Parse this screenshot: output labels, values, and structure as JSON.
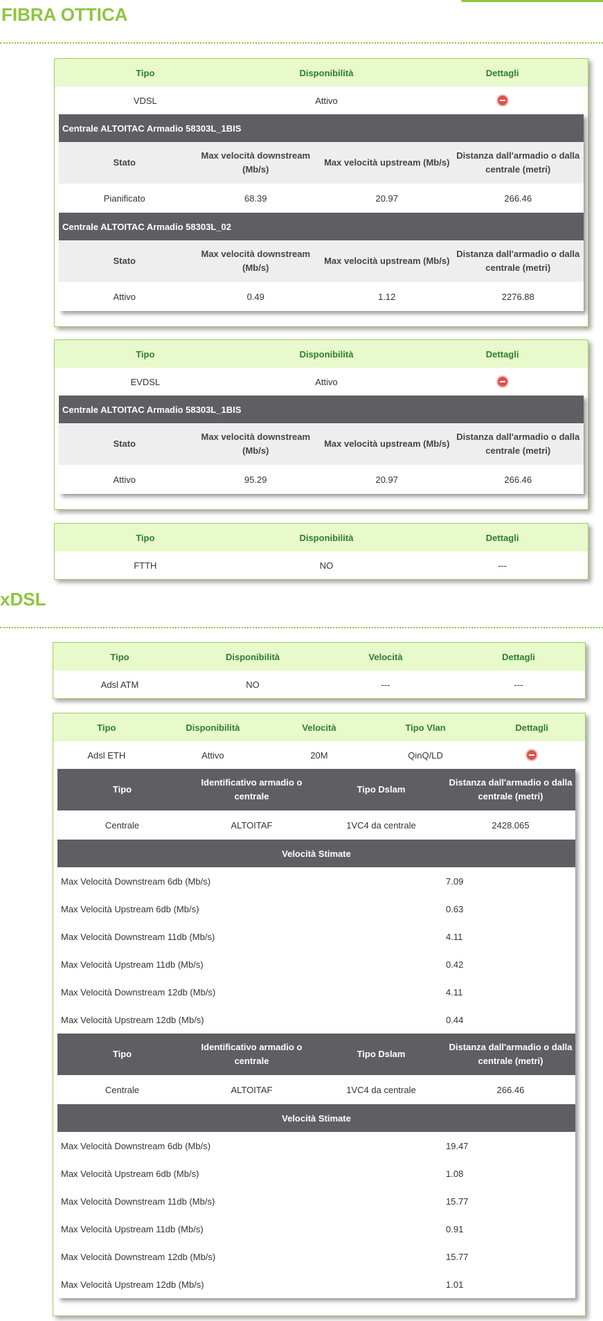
{
  "sections": {
    "fibra_title": "FIBRA OTTICA",
    "xdsl_title": "xDSL"
  },
  "fibra": {
    "headers": [
      "Tipo",
      "Disponibilità",
      "Dettagli"
    ],
    "sub_headers": [
      "Stato",
      "Max velocità downstream (Mb/s)",
      "Max velocità upstream (Mb/s)",
      "Distanza dall'armadio o dalla centrale (metri)"
    ],
    "vdsl": {
      "tipo": "VDSL",
      "disp": "Attivo",
      "dettagli_icon": "minus-circle-icon",
      "groups": [
        {
          "title": "Centrale ALTOITAC Armadio 58303L_1BIS",
          "stato": "Pianificato",
          "down": "68.39",
          "up": "20.97",
          "dist": "266.46"
        },
        {
          "title": "Centrale ALTOITAC Armadio 58303L_02",
          "stato": "Attivo",
          "down": "0.49",
          "up": "1.12",
          "dist": "2276.88"
        }
      ]
    },
    "evdsl": {
      "tipo": "EVDSL",
      "disp": "Attivo",
      "dettagli_icon": "minus-circle-icon",
      "groups": [
        {
          "title": "Centrale ALTOITAC Armadio 58303L_1BIS",
          "stato": "Attivo",
          "down": "95.29",
          "up": "20.97",
          "dist": "266.46"
        }
      ]
    },
    "ftth": {
      "tipo": "FTTH",
      "disp": "NO",
      "dettagli": "---"
    }
  },
  "xdsl": {
    "atm": {
      "headers": [
        "Tipo",
        "Disponibilità",
        "Velocità",
        "Dettagli"
      ],
      "tipo": "Adsl ATM",
      "disp": "NO",
      "vel": "---",
      "dettagli": "---"
    },
    "eth": {
      "headers": [
        "Tipo",
        "Disponibilità",
        "Velocità",
        "Tipo Vlan",
        "Dettagli"
      ],
      "tipo": "Adsl ETH",
      "disp": "Attivo",
      "vel": "20M",
      "vlan": "QinQ/LD",
      "dettagli_icon": "minus-circle-icon",
      "detail_headers": [
        "Tipo",
        "Identificativo armadio o centrale",
        "Tipo Dslam",
        "Distanza dall'armadio o dalla centrale (metri)"
      ],
      "stime_title": "Velocità Stimate",
      "blocks": [
        {
          "tipo": "Centrale",
          "id": "ALTOITAF",
          "dslam": "1VC4 da centrale",
          "dist": "2428.065",
          "stime": [
            {
              "label": "Max Velocità Downstream 6db (Mb/s)",
              "value": "7.09"
            },
            {
              "label": "Max Velocità Upstream 6db (Mb/s)",
              "value": "0.63"
            },
            {
              "label": "Max Velocità Downstream 11db (Mb/s)",
              "value": "4.11"
            },
            {
              "label": "Max Velocità Upstream 11db (Mb/s)",
              "value": "0.42"
            },
            {
              "label": "Max Velocità Downstream 12db (Mb/s)",
              "value": "4.11"
            },
            {
              "label": "Max Velocità Upstream 12db (Mb/s)",
              "value": "0.44"
            }
          ]
        },
        {
          "tipo": "Centrale",
          "id": "ALTOITAF",
          "dslam": "1VC4 da centrale",
          "dist": "266.46",
          "stime": [
            {
              "label": "Max Velocità Downstream 6db (Mb/s)",
              "value": "19.47"
            },
            {
              "label": "Max Velocità Upstream 6db (Mb/s)",
              "value": "1.08"
            },
            {
              "label": "Max Velocità Downstream 11db (Mb/s)",
              "value": "15.77"
            },
            {
              "label": "Max Velocità Upstream 11db (Mb/s)",
              "value": "0.91"
            },
            {
              "label": "Max Velocità Downstream 12db (Mb/s)",
              "value": "15.77"
            },
            {
              "label": "Max Velocità Upstream 12db (Mb/s)",
              "value": "1.01"
            }
          ]
        }
      ]
    }
  }
}
